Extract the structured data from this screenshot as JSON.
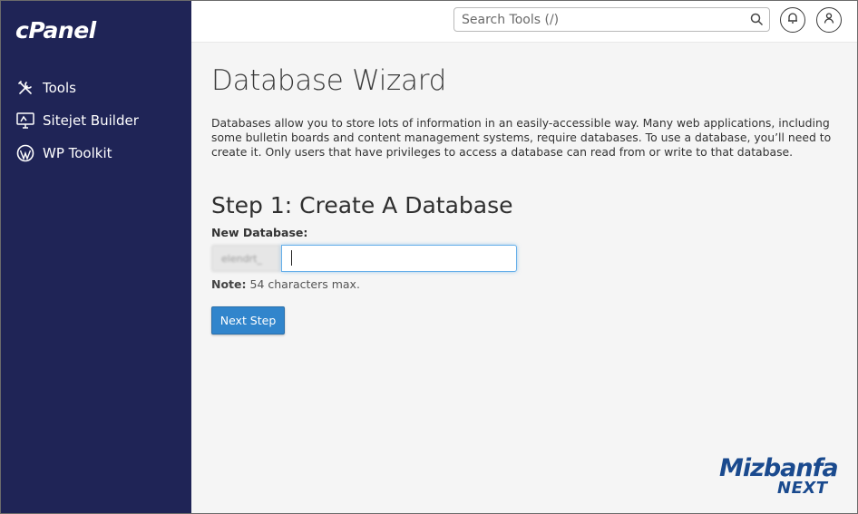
{
  "brand": {
    "logo_text": "cPanel"
  },
  "sidebar": {
    "items": [
      {
        "label": "Tools",
        "icon": "tools-icon"
      },
      {
        "label": "Sitejet Builder",
        "icon": "monitor-icon"
      },
      {
        "label": "WP Toolkit",
        "icon": "wordpress-icon"
      }
    ]
  },
  "header": {
    "search_placeholder": "Search Tools (/)"
  },
  "main": {
    "title": "Database Wizard",
    "description": "Databases allow you to store lots of information in an easily-accessible way. Many web applications, including some bulletin boards and content management systems, require databases. To use a database, you’ll need to create it. Only users that have privileges to access a database can read from or write to that database.",
    "step_title": "Step 1: Create A Database",
    "field_label": "New Database:",
    "prefix_value": "elendrt_",
    "input_value": "",
    "note_label": "Note:",
    "note_text": " 54 characters max.",
    "next_button": "Next Step"
  },
  "watermark": {
    "line1": "Mizbanfa",
    "line2": "NEXT"
  },
  "colors": {
    "sidebar_bg": "#1f2456",
    "accent": "#3185cc",
    "watermark": "#1a4a8e"
  }
}
